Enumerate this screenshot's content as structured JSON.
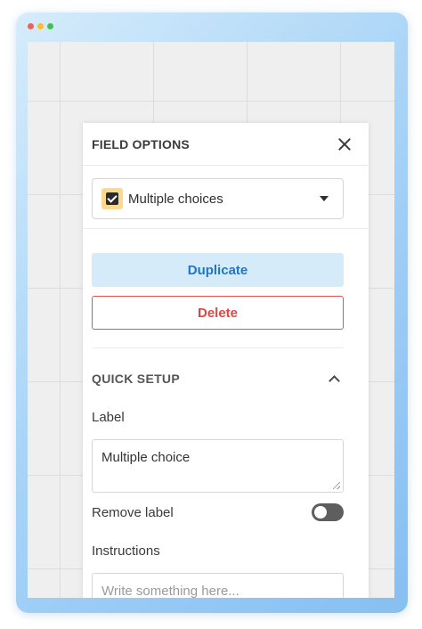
{
  "window": {
    "traffic_lights": [
      "close",
      "minimize",
      "maximize"
    ]
  },
  "panel": {
    "title": "FIELD OPTIONS",
    "field_type": {
      "value": "Multiple choices",
      "icon": "checkbox-icon"
    },
    "actions": {
      "duplicate_label": "Duplicate",
      "delete_label": "Delete"
    },
    "quick_setup": {
      "title": "QUICK SETUP",
      "expanded": true,
      "label_field": {
        "label": "Label",
        "value": "Multiple choice"
      },
      "remove_label": {
        "label": "Remove label",
        "enabled": false
      },
      "instructions_field": {
        "label": "Instructions",
        "value": "",
        "placeholder": "Write something here..."
      }
    }
  },
  "colors": {
    "accent_blue": "#1f76c7",
    "duplicate_bg": "#d6ebfa",
    "danger_red": "#df4545",
    "type_icon_bg": "#fbd98e"
  }
}
